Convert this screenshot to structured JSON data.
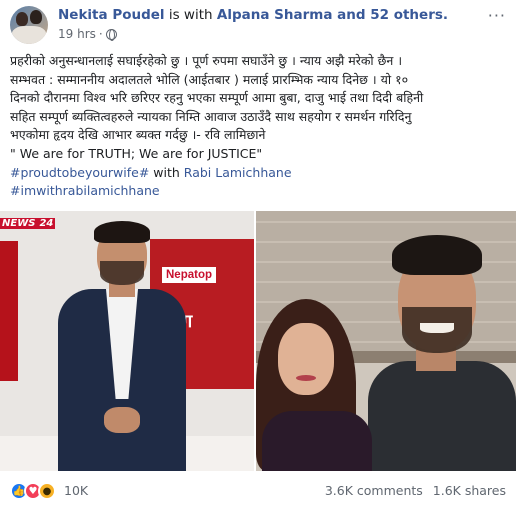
{
  "post": {
    "author": "Nekita Poudel",
    "with_connector": " is with ",
    "tagged": "Alpana Sharma and 52 others.",
    "time": "19 hrs",
    "dot": "·",
    "more_label": "···"
  },
  "body": {
    "line1": "प्रहरीको अनुसन्धानलाई सघाईरहेको छु । पूर्ण रुपमा सघाउँने छु । न्याय अझै मरेको छैन ।",
    "line2": "सम्भवत : सम्माननीय अदालतले भोलि (आईतबार ) मलाई प्रारम्भिक न्याय दिनेछ । यो १०",
    "line3": "दिनको दौरानमा विश्व भरि छरिएर रहनु भएका सम्पूर्ण आमा बुबा, दाजु भाई तथा दिदी बहिनी",
    "line4": "सहित सम्पूर्ण ब्यक्तित्वहरुले न्यायका निम्ति आवाज उठाउँदै साथ सहयोग र समर्थन गरिदिनु",
    "line5": "भएकोमा हृदय देखि आभार ब्यक्त गर्दछु ।- रवि लामिछाने",
    "quote": "\" We are for TRUTH; We are for JUSTICE\"",
    "hashtag1": "#proudtobeyourwife#",
    "with_word": " with ",
    "mention": "Rabi Lamichhane",
    "hashtag2": "#imwithrabilamichhane"
  },
  "images": {
    "left": {
      "news_logo": "NEWS",
      "news_suffix": "24",
      "screen_tag": "Nepatop",
      "screen_big": "सँग"
    }
  },
  "footer": {
    "reactions": [
      "like",
      "love",
      "wow"
    ],
    "reaction_count": "10K",
    "comments": "3.6K comments",
    "shares": "1.6K shares"
  },
  "colors": {
    "link": "#385898",
    "like": "#1877f2",
    "love": "#f33e58",
    "wow": "#f7b125"
  }
}
